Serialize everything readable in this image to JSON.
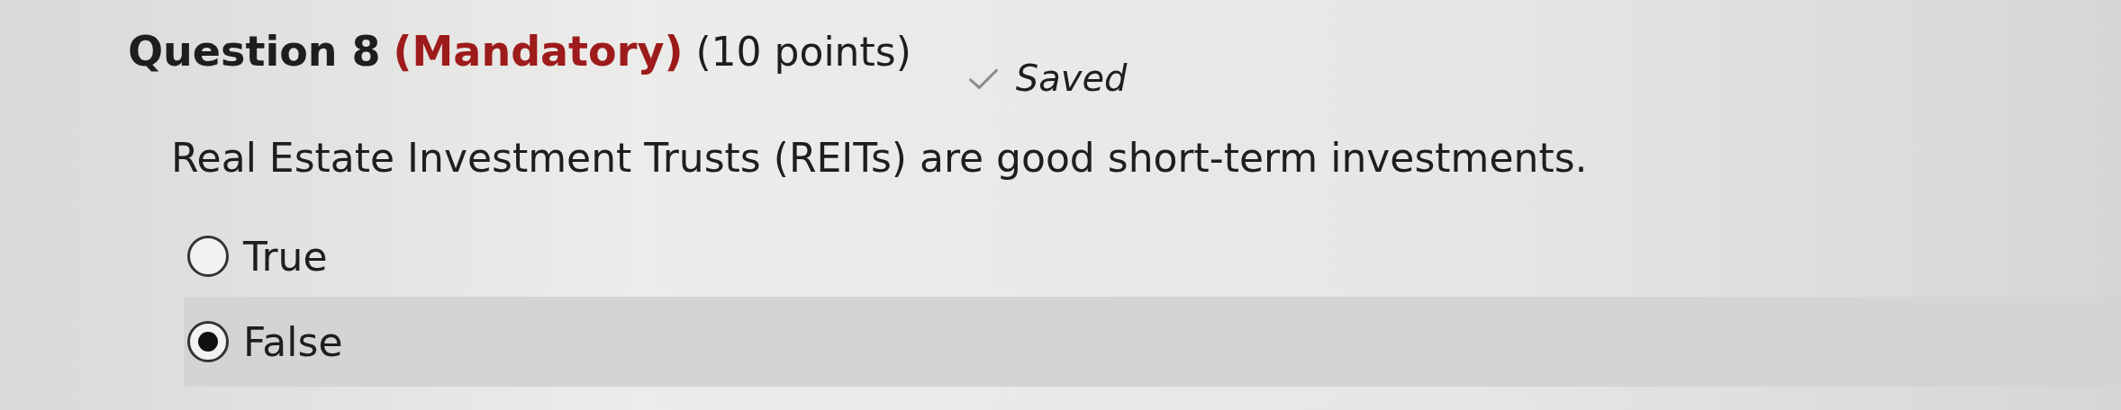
{
  "question": {
    "title": "Question 8",
    "mandatory": "(Mandatory)",
    "points": "(10 points)",
    "save_status": {
      "label": "Saved",
      "saved": true
    },
    "prompt": "Real Estate Investment Trusts (REITs) are good short-term investments.",
    "options": [
      {
        "label": "True",
        "selected": false
      },
      {
        "label": "False",
        "selected": true
      }
    ]
  }
}
